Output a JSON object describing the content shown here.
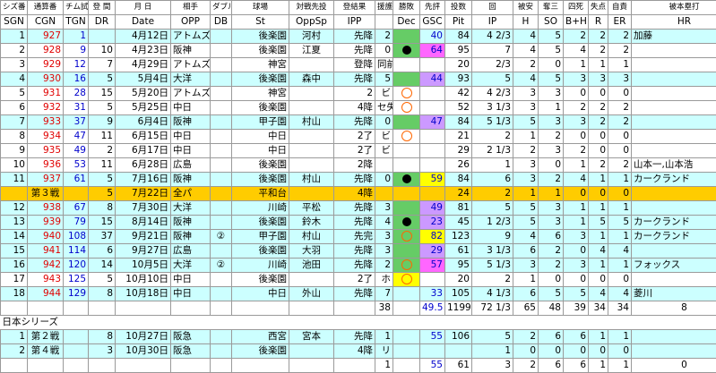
{
  "header1": [
    "シズ番",
    "通算番",
    "チム試",
    "登 間",
    "月 日",
    "相手",
    "ダブル",
    "",
    "球場",
    "対戦先投",
    "登結果",
    "援護",
    "勝敗",
    "先評",
    "投数",
    "回",
    "被安",
    "奪三",
    "四死",
    "失点",
    "自責",
    "被本塁打"
  ],
  "header2": [
    "SGN",
    "CGN",
    "TGN",
    "DR",
    "Date",
    "OPP",
    "DB",
    "St",
    "OppSp",
    "IPP",
    "",
    "Dec",
    "GSC",
    "Pit",
    "IP",
    "H",
    "SO",
    "B+H",
    "R",
    "ER",
    "HR"
  ],
  "rows": [
    {
      "sgn": "1",
      "cgn": "927",
      "tgn": "1",
      "dr": "",
      "date": "4月12日",
      "opp": "アトムズ",
      "db": "",
      "st": "後楽園",
      "oppsp": "河村",
      "ipp": "先降",
      "sup": "2",
      "dec": "",
      "gsc": "40",
      "pit": "84",
      "ip": "4 2/3",
      "h": "4",
      "so": "5",
      "bh": "2",
      "r": "2",
      "er": "2",
      "hr": "加藤",
      "color": "cyan",
      "gscbg": "",
      "decbg": "grn"
    },
    {
      "sgn": "2",
      "cgn": "928",
      "tgn": "9",
      "dr": "10",
      "date": "4月23日",
      "opp": "阪神",
      "db": "",
      "st": "後楽園",
      "oppsp": "江夏",
      "ipp": "先降",
      "sup": "0",
      "dec": "dot",
      "gsc": "64",
      "pit": "95",
      "ip": "7",
      "h": "4",
      "so": "5",
      "bh": "4",
      "r": "2",
      "er": "2",
      "hr": "",
      "color": "white",
      "gscbg": "pink",
      "decbg": "grn"
    },
    {
      "sgn": "3",
      "cgn": "929",
      "tgn": "12",
      "dr": "7",
      "date": "4月29日",
      "opp": "アトムズ",
      "db": "",
      "st": "神宮",
      "oppsp": "",
      "ipp": "登降",
      "sup": "0",
      "dec": "",
      "gsc": "",
      "pit": "20",
      "ip": "2/3",
      "h": "2",
      "so": "0",
      "bh": "1",
      "r": "1",
      "er": "1",
      "hr": "",
      "color": "white",
      "gscbg": "",
      "decbg": "",
      "ippsp": "同前"
    },
    {
      "sgn": "4",
      "cgn": "930",
      "tgn": "16",
      "dr": "5",
      "date": "5月4日",
      "opp": "大洋",
      "db": "",
      "st": "後楽園",
      "oppsp": "森中",
      "ipp": "先降",
      "sup": "5",
      "dec": "",
      "gsc": "44",
      "pit": "93",
      "ip": "5",
      "h": "4",
      "so": "5",
      "bh": "3",
      "r": "3",
      "er": "3",
      "hr": "",
      "color": "cyan",
      "gscbg": "lav",
      "decbg": "grn"
    },
    {
      "sgn": "5",
      "cgn": "931",
      "tgn": "28",
      "dr": "15",
      "date": "5月20日",
      "opp": "アトムズ",
      "db": "",
      "st": "神宮",
      "oppsp": "",
      "ipp": "2",
      "sup": "ビ",
      "dec": "circ",
      "gsc": "",
      "pit": "42",
      "ip": "4 2/3",
      "h": "3",
      "so": "3",
      "bh": "0",
      "r": "0",
      "er": "0",
      "hr": "",
      "color": "white",
      "gscbg": "",
      "decbg": ""
    },
    {
      "sgn": "6",
      "cgn": "932",
      "tgn": "31",
      "dr": "5",
      "date": "5月25日",
      "opp": "中日",
      "db": "",
      "st": "後楽園",
      "oppsp": "",
      "ipp": "4降",
      "sup": "セ失",
      "dec": "circ",
      "gsc": "",
      "pit": "52",
      "ip": "3 1/3",
      "h": "3",
      "so": "1",
      "bh": "2",
      "r": "2",
      "er": "2",
      "hr": "",
      "color": "white",
      "gscbg": "",
      "decbg": ""
    },
    {
      "sgn": "7",
      "cgn": "933",
      "tgn": "37",
      "dr": "9",
      "date": "6月4日",
      "opp": "阪神",
      "db": "",
      "st": "甲子園",
      "oppsp": "村山",
      "ipp": "先降",
      "sup": "0",
      "dec": "",
      "gsc": "47",
      "pit": "84",
      "ip": "5 1/3",
      "h": "5",
      "so": "3",
      "bh": "3",
      "r": "2",
      "er": "2",
      "hr": "",
      "color": "cyan",
      "gscbg": "lav",
      "decbg": "grn"
    },
    {
      "sgn": "8",
      "cgn": "934",
      "tgn": "47",
      "dr": "11",
      "date": "6月15日",
      "opp": "中日",
      "db": "",
      "st": "中日",
      "oppsp": "",
      "ipp": "2了",
      "sup": "ビ",
      "dec": "circ",
      "gsc": "",
      "pit": "21",
      "ip": "2",
      "h": "1",
      "so": "2",
      "bh": "0",
      "r": "0",
      "er": "0",
      "hr": "",
      "color": "white",
      "gscbg": "",
      "decbg": ""
    },
    {
      "sgn": "9",
      "cgn": "935",
      "tgn": "49",
      "dr": "2",
      "date": "6月17日",
      "opp": "中日",
      "db": "",
      "st": "中日",
      "oppsp": "",
      "ipp": "2了",
      "sup": "ビ",
      "dec": "",
      "gsc": "",
      "pit": "29",
      "ip": "2 1/3",
      "h": "2",
      "so": "3",
      "bh": "2",
      "r": "0",
      "er": "0",
      "hr": "",
      "color": "white",
      "gscbg": "",
      "decbg": ""
    },
    {
      "sgn": "10",
      "cgn": "936",
      "tgn": "53",
      "dr": "11",
      "date": "6月28日",
      "opp": "広島",
      "db": "",
      "st": "後楽園",
      "oppsp": "",
      "ipp": "2降",
      "sup": "",
      "dec": "",
      "gsc": "",
      "pit": "26",
      "ip": "1",
      "h": "3",
      "so": "0",
      "bh": "1",
      "r": "2",
      "er": "2",
      "hr": "山本一,山本浩",
      "color": "white",
      "gscbg": "",
      "decbg": ""
    },
    {
      "sgn": "11",
      "cgn": "937",
      "tgn": "61",
      "dr": "5",
      "date": "7月16日",
      "opp": "阪神",
      "db": "",
      "st": "後楽園",
      "oppsp": "村山",
      "ipp": "先降",
      "sup": "0",
      "dec": "dot",
      "gsc": "59",
      "pit": "84",
      "ip": "6",
      "h": "3",
      "so": "2",
      "bh": "4",
      "r": "1",
      "er": "1",
      "hr": "カークランド",
      "color": "cyan",
      "gscbg": "yel",
      "decbg": "grn"
    },
    {
      "sgn": "",
      "cgn": "第３戦",
      "tgn": "",
      "dr": "5",
      "date": "7月22日",
      "opp": "全パ",
      "db": "",
      "st": "平和台",
      "oppsp": "",
      "ipp": "4降",
      "sup": "",
      "dec": "",
      "gsc": "",
      "pit": "24",
      "ip": "2",
      "h": "1",
      "so": "1",
      "bh": "0",
      "r": "0",
      "er": "0",
      "hr": "",
      "color": "orange",
      "gscbg": "",
      "decbg": ""
    },
    {
      "sgn": "12",
      "cgn": "938",
      "tgn": "67",
      "dr": "8",
      "date": "7月30日",
      "opp": "大洋",
      "db": "",
      "st": "川崎",
      "oppsp": "平松",
      "ipp": "先降",
      "sup": "3",
      "dec": "",
      "gsc": "49",
      "pit": "81",
      "ip": "5",
      "h": "5",
      "so": "3",
      "bh": "1",
      "r": "1",
      "er": "1",
      "hr": "",
      "color": "cyan",
      "gscbg": "lav",
      "decbg": "grn"
    },
    {
      "sgn": "13",
      "cgn": "939",
      "tgn": "79",
      "dr": "15",
      "date": "8月14日",
      "opp": "阪神",
      "db": "",
      "st": "後楽園",
      "oppsp": "鈴木",
      "ipp": "先降",
      "sup": "4",
      "dec": "dot",
      "gsc": "23",
      "pit": "45",
      "ip": "1 2/3",
      "h": "5",
      "so": "3",
      "bh": "1",
      "r": "5",
      "er": "5",
      "hr": "カークランド",
      "color": "cyan",
      "gscbg": "lav",
      "decbg": "grn"
    },
    {
      "sgn": "14",
      "cgn": "940",
      "tgn": "108",
      "dr": "37",
      "date": "9月21日",
      "opp": "阪神",
      "db": "②",
      "st": "甲子園",
      "oppsp": "村山",
      "ipp": "先完",
      "sup": "3",
      "dec": "circ",
      "gsc": "82",
      "pit": "123",
      "ip": "9",
      "h": "4",
      "so": "6",
      "bh": "3",
      "r": "1",
      "er": "1",
      "hr": "カークランド",
      "color": "cyan",
      "gscbg": "yel",
      "decbg": "grn"
    },
    {
      "sgn": "15",
      "cgn": "941",
      "tgn": "114",
      "dr": "6",
      "date": "9月27日",
      "opp": "広島",
      "db": "",
      "st": "後楽園",
      "oppsp": "大羽",
      "ipp": "先降",
      "sup": "3",
      "dec": "",
      "gsc": "29",
      "pit": "61",
      "ip": "3 1/3",
      "h": "6",
      "so": "2",
      "bh": "0",
      "r": "4",
      "er": "4",
      "hr": "",
      "color": "cyan",
      "gscbg": "lav",
      "decbg": "grn"
    },
    {
      "sgn": "16",
      "cgn": "942",
      "tgn": "120",
      "dr": "14",
      "date": "10月5日",
      "opp": "大洋",
      "db": "②",
      "st": "川崎",
      "oppsp": "池田",
      "ipp": "先降",
      "sup": "2",
      "dec": "circ",
      "gsc": "57",
      "pit": "95",
      "ip": "5 1/3",
      "h": "3",
      "so": "2",
      "bh": "3",
      "r": "1",
      "er": "1",
      "hr": "フォックス",
      "color": "cyan",
      "gscbg": "pink",
      "decbg": "grn"
    },
    {
      "sgn": "17",
      "cgn": "943",
      "tgn": "125",
      "dr": "5",
      "date": "10月10日",
      "opp": "中日",
      "db": "",
      "st": "後楽園",
      "oppsp": "",
      "ipp": "2了",
      "sup": "ホ",
      "dec": "circ",
      "gsc": "",
      "pit": "20",
      "ip": "2",
      "h": "1",
      "so": "0",
      "bh": "0",
      "r": "0",
      "er": "0",
      "hr": "",
      "color": "white",
      "gscbg": "",
      "decbg": "yel"
    },
    {
      "sgn": "18",
      "cgn": "944",
      "tgn": "129",
      "dr": "8",
      "date": "10月18日",
      "opp": "中日",
      "db": "",
      "st": "中日",
      "oppsp": "外山",
      "ipp": "先降",
      "sup": "7",
      "dec": "",
      "gsc": "33",
      "pit": "105",
      "ip": "4 1/3",
      "h": "6",
      "so": "5",
      "bh": "5",
      "r": "4",
      "er": "4",
      "hr": "菱川",
      "color": "cyan",
      "gscbg": "",
      "decbg": ""
    }
  ],
  "totals1": {
    "sup": "38",
    "gsc": "49.5",
    "pit": "1199",
    "ip": "72 1/3",
    "h": "65",
    "so": "48",
    "bh": "39",
    "r": "34",
    "er": "34",
    "hr": "8"
  },
  "series_title": "日本シリーズ",
  "series_rows": [
    {
      "sgn": "1",
      "cgn": "第２戦",
      "dr": "8",
      "date": "10月27日",
      "opp": "阪急",
      "st": "西宮",
      "oppsp": "宮本",
      "ipp": "先降",
      "sup": "1",
      "gsc": "55",
      "pit": "106",
      "ip": "5",
      "h": "2",
      "so": "6",
      "bh": "6",
      "r": "1",
      "er": "1"
    },
    {
      "sgn": "2",
      "cgn": "第４戦",
      "dr": "3",
      "date": "10月30日",
      "opp": "阪急",
      "st": "後楽園",
      "oppsp": "",
      "ipp": "4降",
      "sup": "リ",
      "gsc": "",
      "pit": "",
      "ip": "1",
      "h": "0",
      "so": "0",
      "bh": "0",
      "r": "0",
      "er": "0"
    }
  ],
  "totals2": {
    "sup": "1",
    "gsc": "55",
    "pit": "61",
    "ip": "3",
    "h": "2",
    "so": "6",
    "bh": "6",
    "r": "1",
    "er": "1",
    "hr": "0"
  }
}
